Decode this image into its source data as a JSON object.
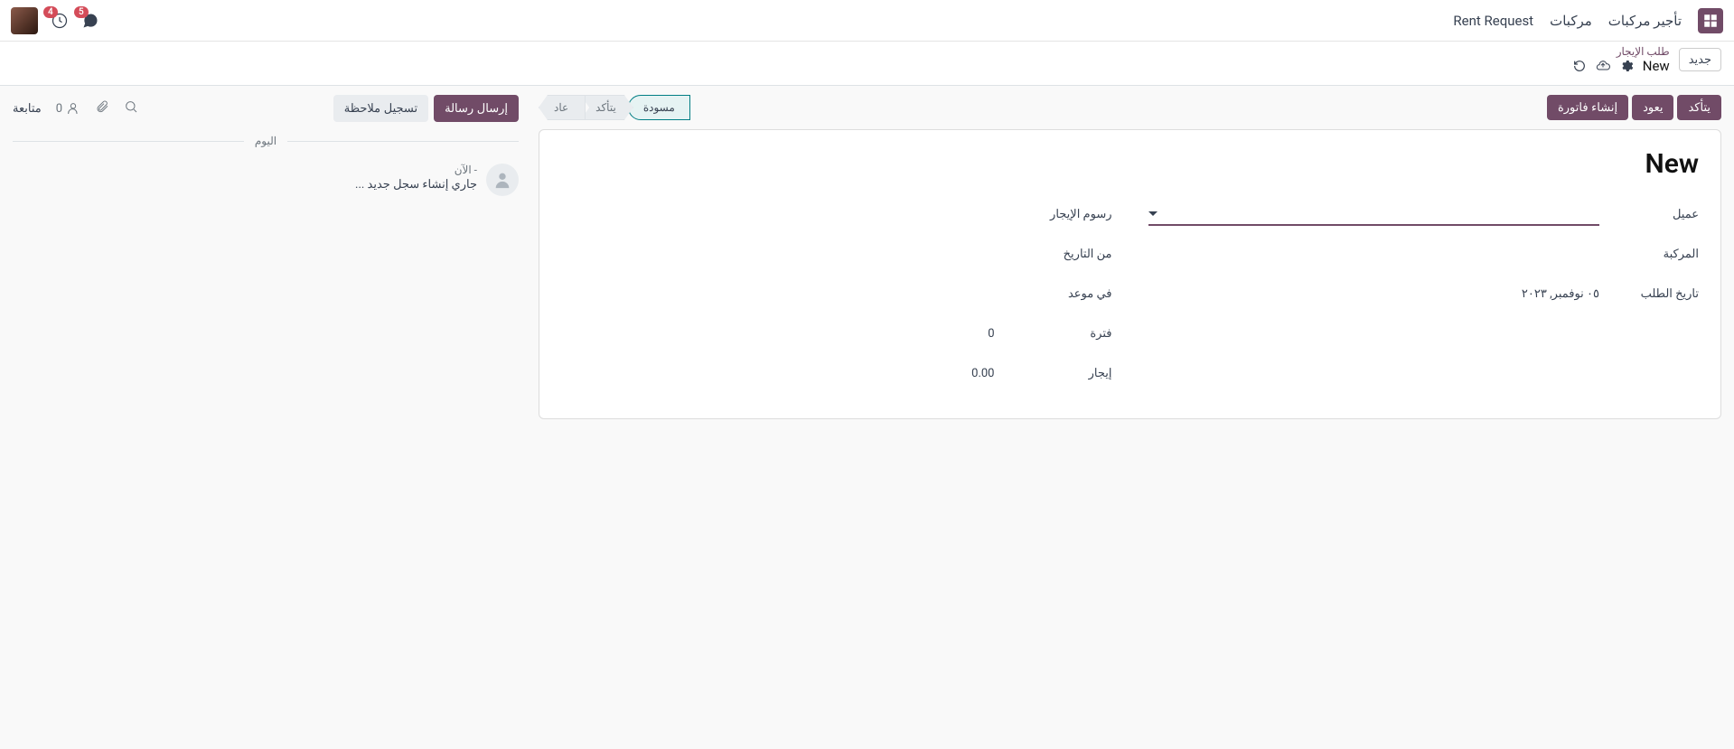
{
  "nav": {
    "app_title": "تأجير مركبات",
    "menu1": "مركبات",
    "menu2": "Rent Request",
    "msg_badge": "5",
    "act_badge": "4"
  },
  "crumb": {
    "new_btn": "جديد",
    "link": "طلب الإيجار",
    "current": "New"
  },
  "actions": {
    "confirm": "يتأكد",
    "return": "يعود",
    "invoice": "إنشاء فاتورة"
  },
  "status": {
    "draft": "مسودة",
    "confirm": "يتأكد",
    "returned": "عاد"
  },
  "form": {
    "title": "New",
    "customer_label": "عميل",
    "vehicle_label": "المركبة",
    "request_date_label": "تاريخ الطلب",
    "request_date_value": "٠٥ نوفمبر, ٢٠٢٣",
    "rent_fees_label": "رسوم الإيجار",
    "from_date_label": "من التاريخ",
    "to_date_label": "في موعد",
    "period_label": "فترة",
    "period_value": "0",
    "rent_label": "إيجار",
    "rent_value": "0.00"
  },
  "chatter": {
    "send_msg": "إرسال رسالة",
    "log_note": "تسجيل ملاحظة",
    "follow": "متابعة",
    "followers": "0",
    "divider": "اليوم",
    "log_time": "- الآن",
    "log_text": "جاري إنشاء سجل جديد ..."
  }
}
